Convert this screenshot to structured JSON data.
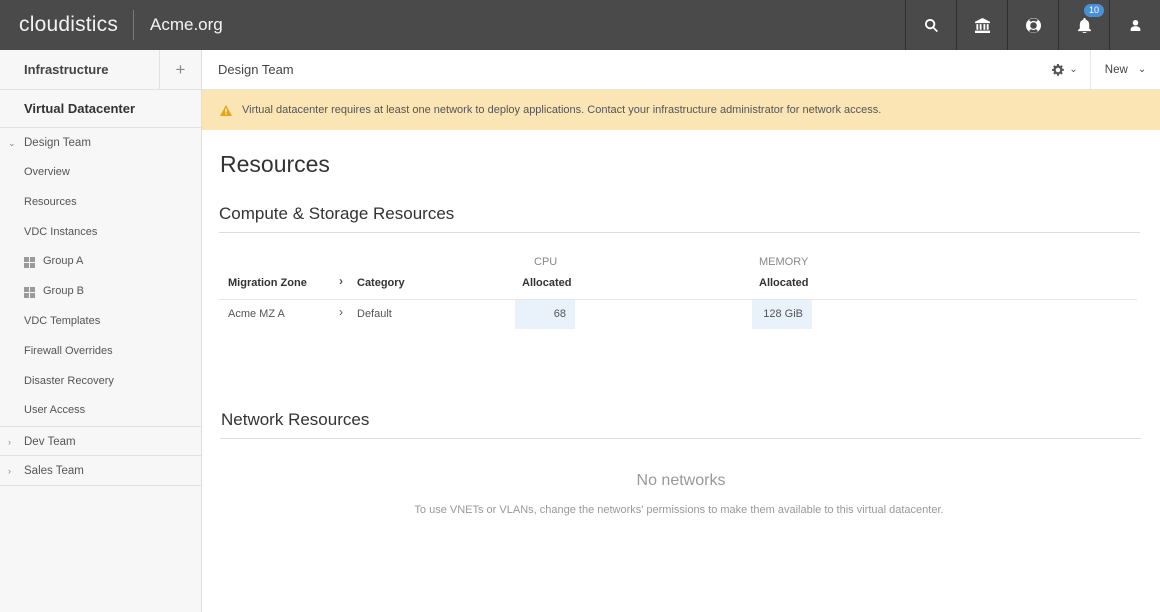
{
  "topbar": {
    "brand": "cloudistics",
    "org": "Acme.org",
    "notification_count": "10",
    "icons": [
      "search-icon",
      "bank-icon",
      "lifebuoy-icon",
      "bell-icon",
      "user-icon"
    ]
  },
  "sidebar": {
    "infrastructure_label": "Infrastructure",
    "add_label": "+",
    "vdc_label": "Virtual Datacenter",
    "groups": {
      "design": "Design Team",
      "dev": "Dev Team",
      "sales": "Sales Team"
    },
    "items": {
      "overview": "Overview",
      "resources": "Resources",
      "vdc_instances": "VDC Instances",
      "group_a": "Group A",
      "group_b": "Group B",
      "vdc_templates": "VDC Templates",
      "firewall_overrides": "Firewall Overrides",
      "disaster_recovery": "Disaster Recovery",
      "user_access": "User Access"
    }
  },
  "header": {
    "title": "Design Team",
    "new_label": "New"
  },
  "alert": {
    "text": "Virtual datacenter requires at least one network to deploy applications. Contact your infrastructure administrator for network access.",
    "color": "#fbe5b5"
  },
  "main": {
    "page_title": "Resources",
    "compute_title": "Compute & Storage Resources",
    "table": {
      "cpu_group": "CPU",
      "memory_group": "MEMORY",
      "headers": {
        "zone": "Migration Zone",
        "category": "Category",
        "cpu_allocated": "Allocated",
        "memory_allocated": "Allocated"
      },
      "row": {
        "zone": "Acme MZ A",
        "category": "Default",
        "cpu": "68",
        "memory": "128 GiB"
      }
    },
    "network_title": "Network Resources",
    "empty_title": "No networks",
    "empty_text": "To use VNETs or VLANs, change the networks' permissions to make them available to this virtual datacenter."
  }
}
